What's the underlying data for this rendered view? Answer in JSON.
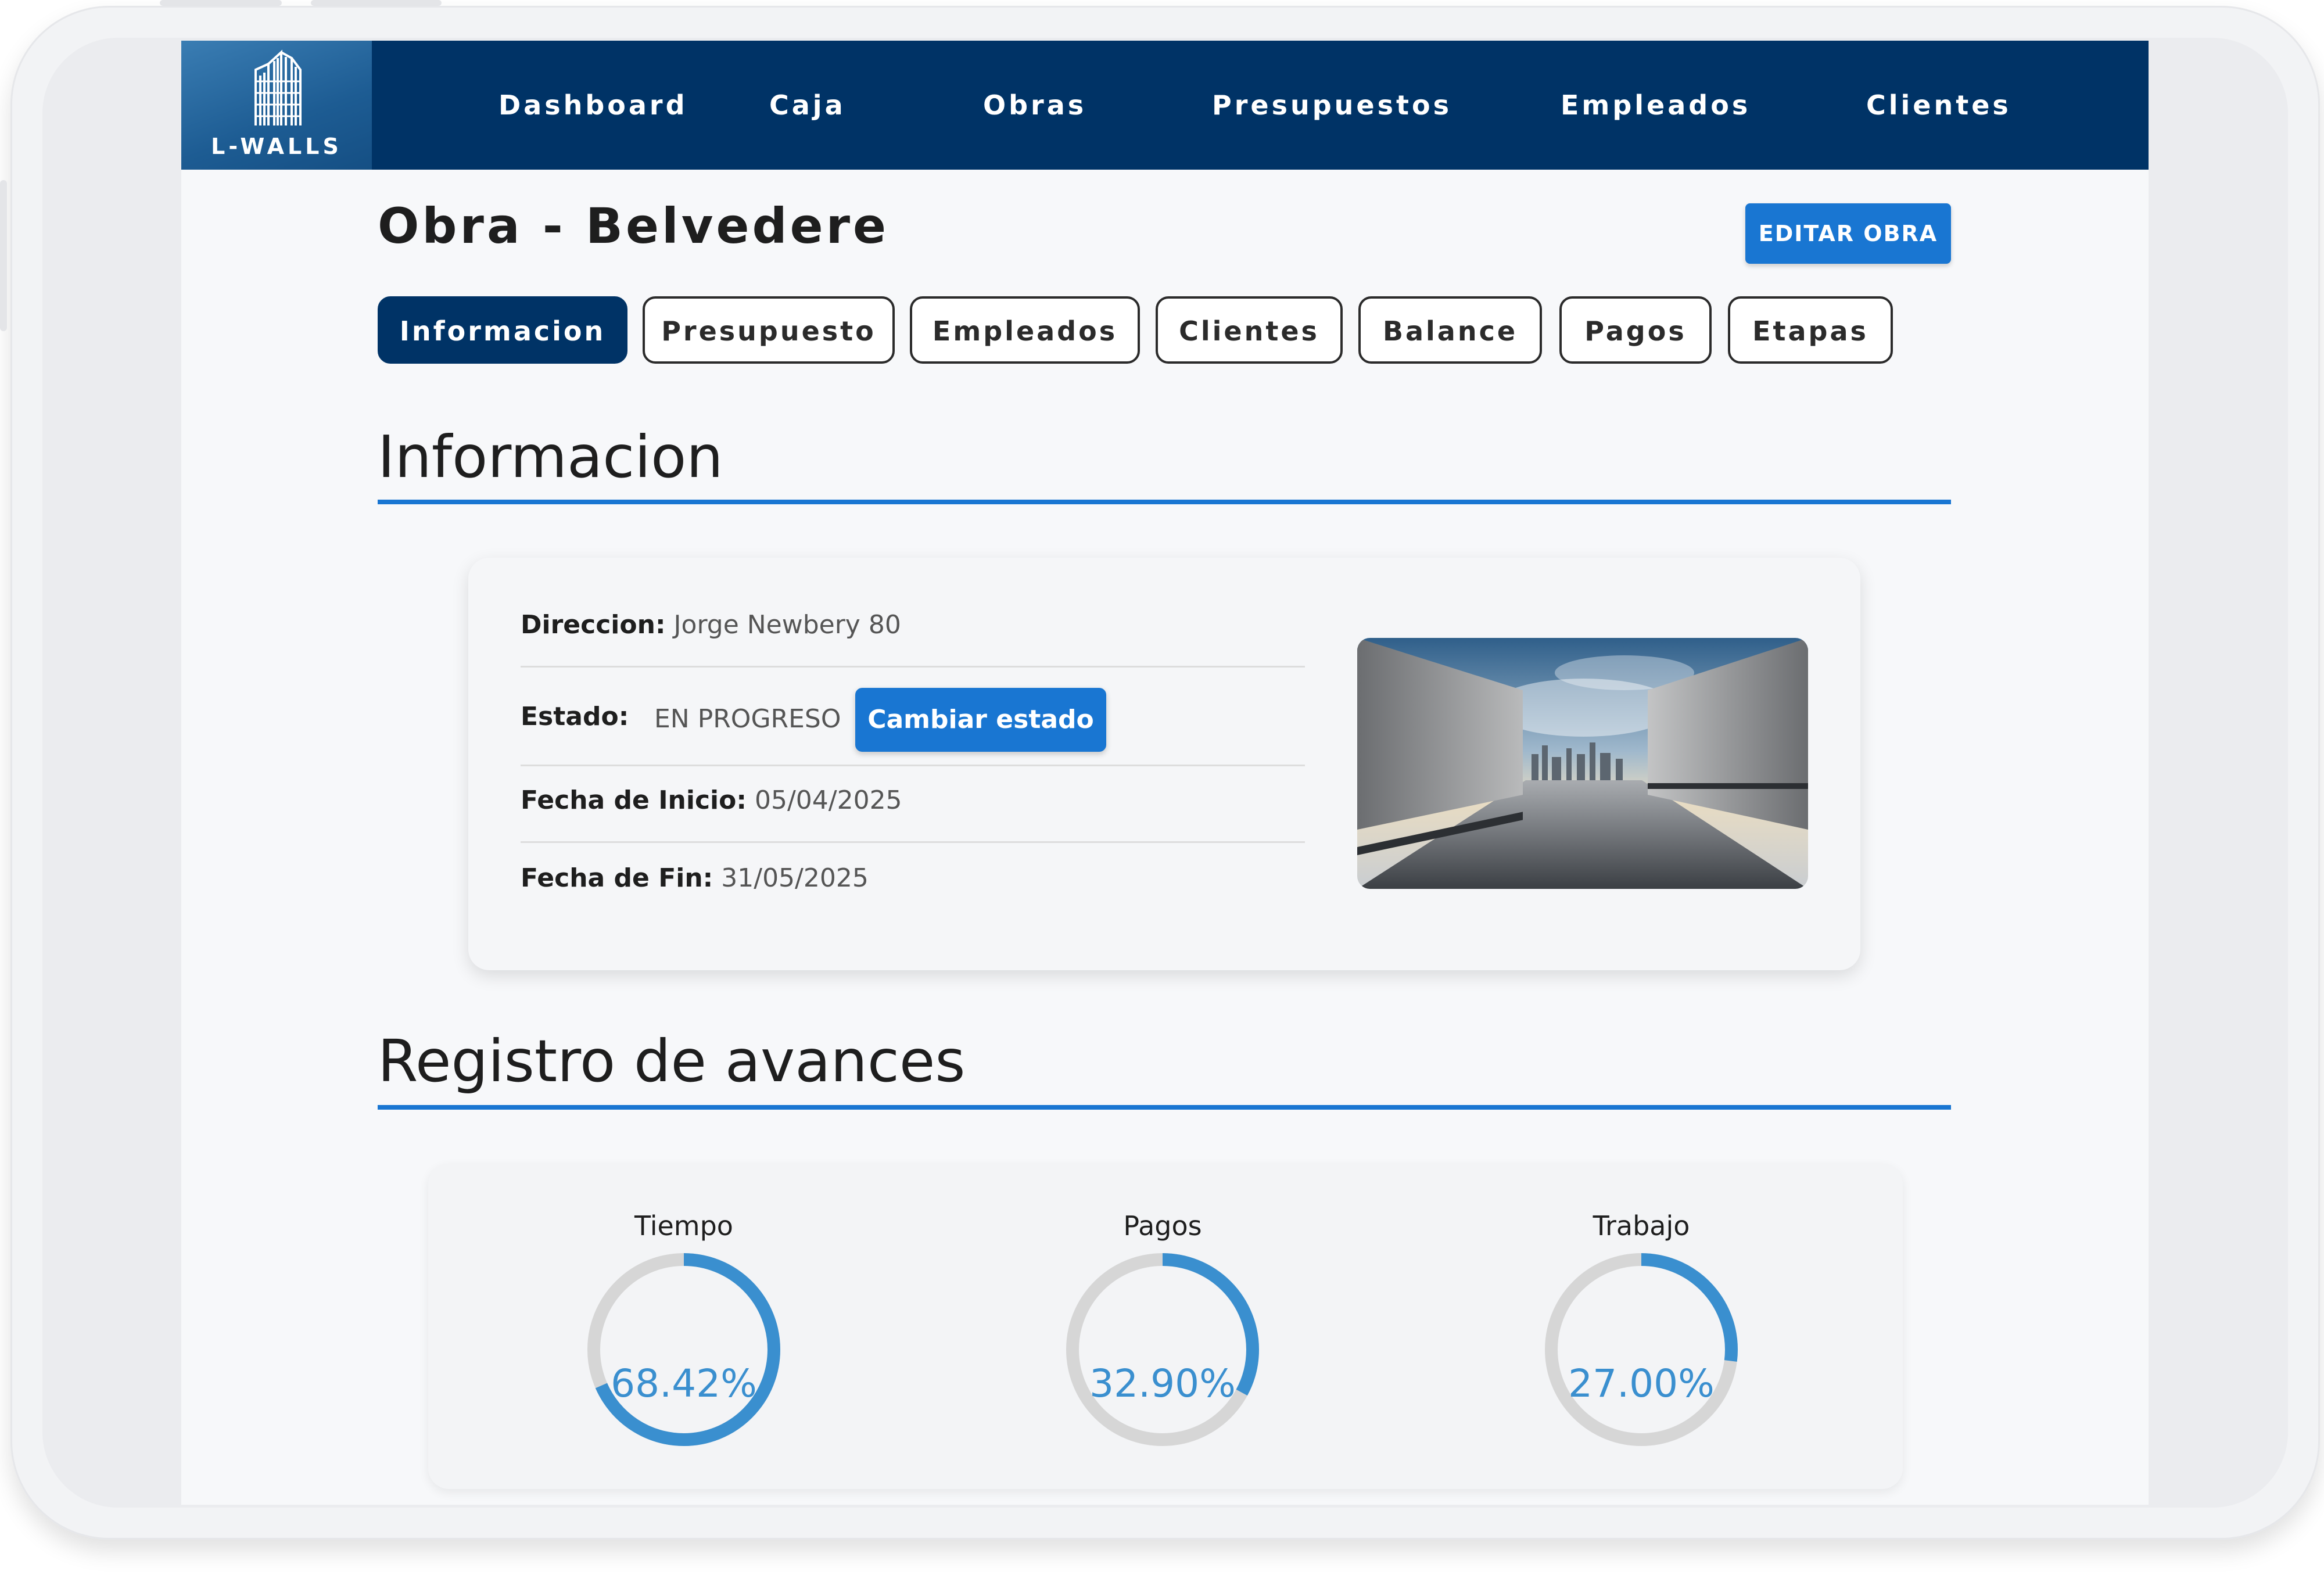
{
  "app": {
    "logo_text": "L-WALLS"
  },
  "nav": {
    "items": [
      {
        "label": "Dashboard"
      },
      {
        "label": "Caja"
      },
      {
        "label": "Obras"
      },
      {
        "label": "Presupuestos"
      },
      {
        "label": "Empleados"
      },
      {
        "label": "Clientes"
      }
    ]
  },
  "page": {
    "title": "Obra - Belvedere",
    "edit_button": "EDITAR OBRA"
  },
  "tabs": [
    {
      "label": "Informacion",
      "active": true
    },
    {
      "label": "Presupuesto"
    },
    {
      "label": "Empleados"
    },
    {
      "label": "Clientes"
    },
    {
      "label": "Balance"
    },
    {
      "label": "Pagos"
    },
    {
      "label": "Etapas"
    }
  ],
  "info": {
    "section_title": "Informacion",
    "direccion_label": "Direccion:",
    "direccion_value": "Jorge Newbery 80",
    "estado_label": "Estado:",
    "estado_value": "EN PROGRESO",
    "cambiar_estado": "Cambiar estado",
    "fecha_inicio_label": "Fecha de Inicio:",
    "fecha_inicio_value": "05/04/2025",
    "fecha_fin_label": "Fecha de Fin:",
    "fecha_fin_value": "31/05/2025"
  },
  "avances": {
    "section_title": "Registro de avances",
    "gauges": [
      {
        "label": "Tiempo",
        "value_text": "68.42%",
        "percent": 68.42
      },
      {
        "label": "Pagos",
        "value_text": "32.90%",
        "percent": 32.9
      },
      {
        "label": "Trabajo",
        "value_text": "27.00%",
        "percent": 27.0
      }
    ]
  },
  "colors": {
    "navbar": "#003366",
    "accent": "#1976d2",
    "gauge_fill": "#3a8fcf",
    "gauge_track": "#d6d6d6"
  }
}
